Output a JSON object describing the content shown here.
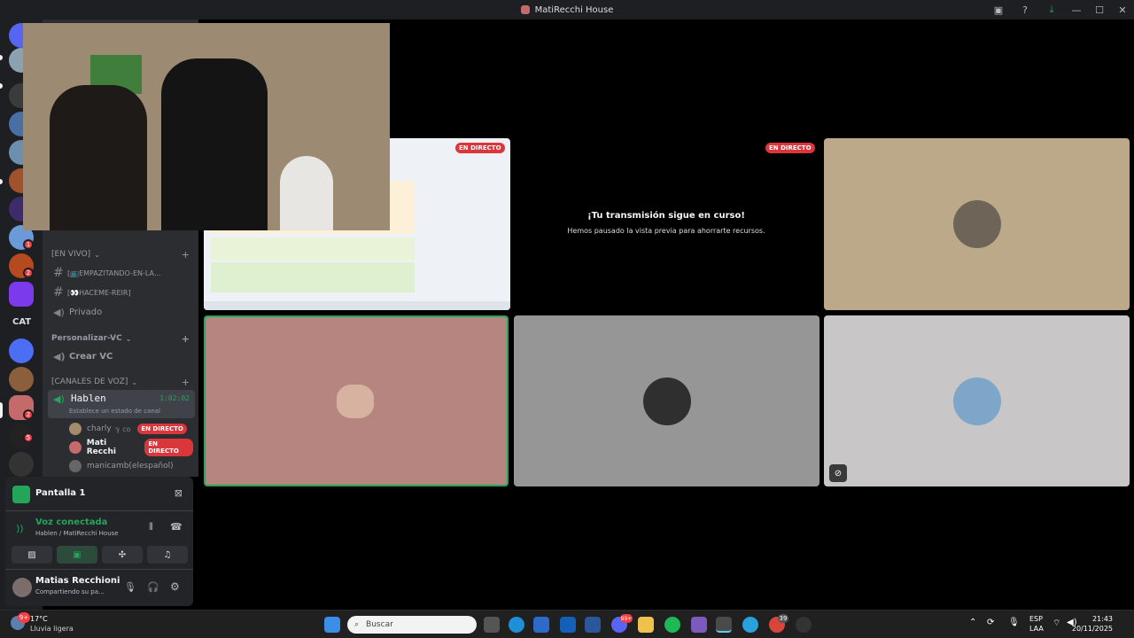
{
  "window": {
    "title": "MatiRecchi House"
  },
  "rail": {
    "cat_label": "CAT",
    "badges": [
      "1",
      "2",
      "2",
      "5"
    ]
  },
  "sidebar": {
    "categories": [
      {
        "label": "[EN VIVO]"
      },
      {
        "label": "Personalizar-VC"
      },
      {
        "label": "[CANALES DE VOZ]"
      }
    ],
    "channels": [
      {
        "label": "[📺EMPAZITANDO-EN-LA..."
      },
      {
        "label": "[👀HACEME-REIR]"
      },
      {
        "label": "Privado"
      },
      {
        "label": "Crear VC"
      }
    ],
    "voice_channel": {
      "name": "Hablen",
      "timer": "1:02:02",
      "status_prompt": "Establece un estado de canal"
    },
    "voice_users": [
      {
        "name": "charly",
        "live": "EN DIRECTO"
      },
      {
        "name": "Mati Recchi",
        "live": "EN DIRECTO"
      },
      {
        "name": "manicamb(elespañol)"
      }
    ]
  },
  "panel": {
    "screen_label": "Pantalla 1",
    "voice_status": "Voz conectada",
    "voice_location": "Hablen / MatiRecchi House",
    "user_name": "Matias Recchioni",
    "user_status": "Compartiendo su pa..."
  },
  "content": {
    "live_label": "EN DIRECTO",
    "paused_title": "¡Tu transmisión sigue en curso!",
    "paused_sub": "Hemos pausado la vista previa para ahorrarte recursos."
  },
  "taskbar": {
    "weather_temp": "17°C",
    "weather_desc": "Lluvia ligera",
    "search_placeholder": "Buscar",
    "lang_top": "ESP",
    "lang_bottom": "LAA",
    "time": "21:43",
    "date": "20/11/2025",
    "weather_badge": "9+",
    "discord_badge": "99+",
    "chrome_badge": "39"
  },
  "colors": {
    "accent_green": "#23a55a",
    "live_red": "#da373c",
    "tile_pink": "#b7857f",
    "tile_gray": "#969696",
    "tile_light": "#c8c6c6",
    "tile_tan": "#bca98a"
  }
}
